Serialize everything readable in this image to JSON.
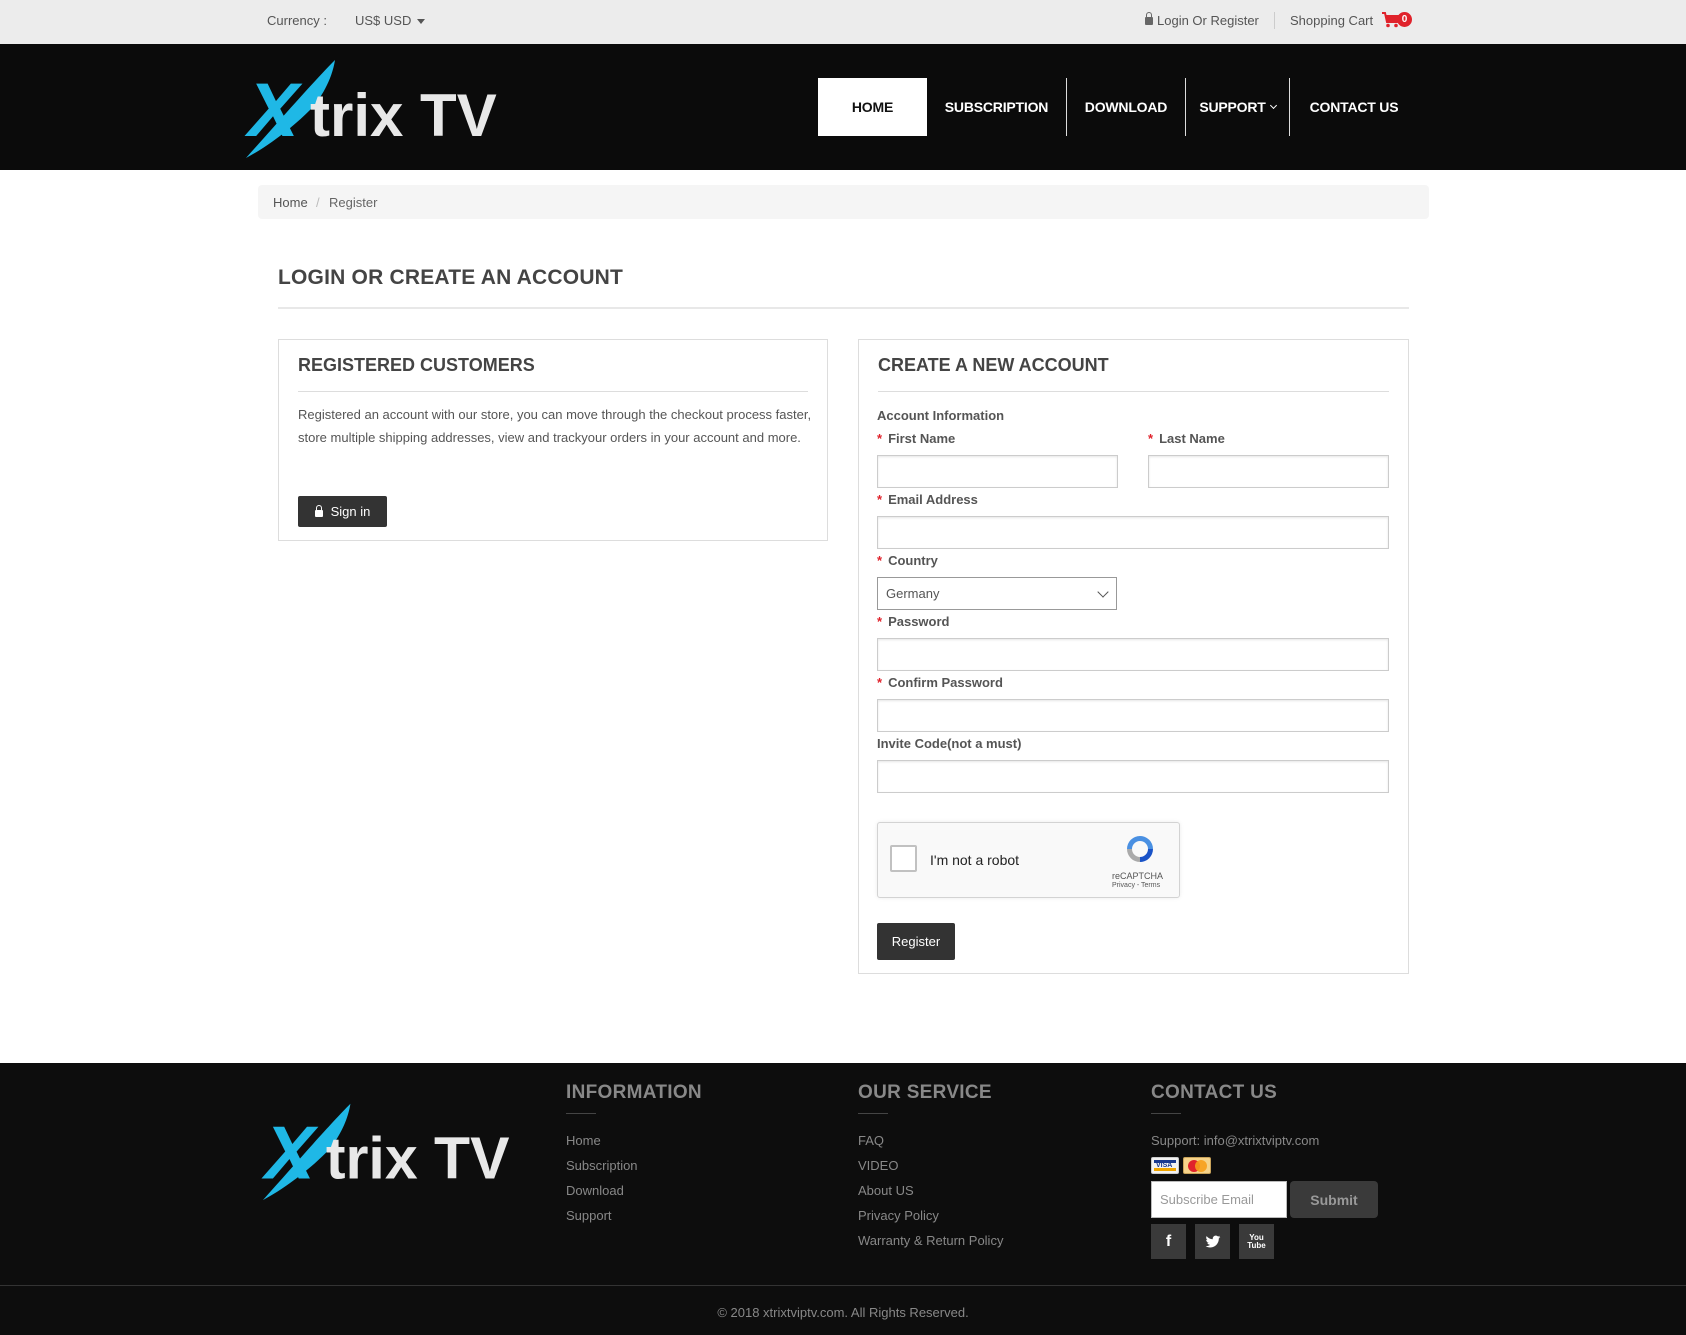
{
  "topbar": {
    "currency_label": "Currency :",
    "currency_value": "US$ USD",
    "login_label": "Login Or Register",
    "cart_label": "Shopping Cart",
    "cart_count": "0"
  },
  "header": {
    "logo_text": "trix TV",
    "logo_x": "X",
    "nav": {
      "home": "HOME",
      "subscription": "SUBSCRIPTION",
      "download": "DOWNLOAD",
      "support": "SUPPORT",
      "contact": "CONTACT US"
    }
  },
  "breadcrumb": {
    "home": "Home",
    "separator": "/",
    "current": "Register"
  },
  "page": {
    "title": "LOGIN OR CREATE AN ACCOUNT"
  },
  "registered": {
    "title": "REGISTERED CUSTOMERS",
    "description": "Registered an account with our store, you can move through the checkout process faster, store multiple shipping addresses, view and trackyour orders in your account and more.",
    "signin_label": "Sign in"
  },
  "create": {
    "title": "CREATE A NEW ACCOUNT",
    "section_label": "Account Information",
    "required_mark": "*",
    "first_name_label": "First Name",
    "last_name_label": "Last Name",
    "email_label": "Email Address",
    "country_label": "Country",
    "country_value": "Germany",
    "password_label": "Password",
    "confirm_password_label": "Confirm Password",
    "invite_label": "Invite Code(not a must)",
    "recaptcha_text": "I'm not a robot",
    "recaptcha_brand": "reCAPTCHA",
    "recaptcha_terms": "Privacy - Terms",
    "register_label": "Register"
  },
  "footer": {
    "information": {
      "title": "INFORMATION",
      "links": [
        "Home",
        "Subscription",
        "Download",
        "Support"
      ]
    },
    "service": {
      "title": "OUR SERVICE",
      "links": [
        "FAQ",
        "VIDEO",
        "About US",
        "Privacy Policy",
        "Warranty & Return Policy"
      ]
    },
    "contact": {
      "title": "CONTACT US",
      "support": "Support: info@xtrixtviptv.com",
      "visa_label": "VISA",
      "subscribe_placeholder": "Subscribe Email",
      "submit_label": "Submit",
      "social": {
        "facebook": "f",
        "twitter": "t",
        "youtube": "You Tube"
      }
    },
    "copyright": "© 2018 xtrixtviptv.com. All Rights Reserved."
  },
  "colors": {
    "accent_cyan": "#1fb8e6",
    "badge_red": "#e0222b",
    "header_bg": "#0b0b0b",
    "button_dark": "#333333"
  }
}
